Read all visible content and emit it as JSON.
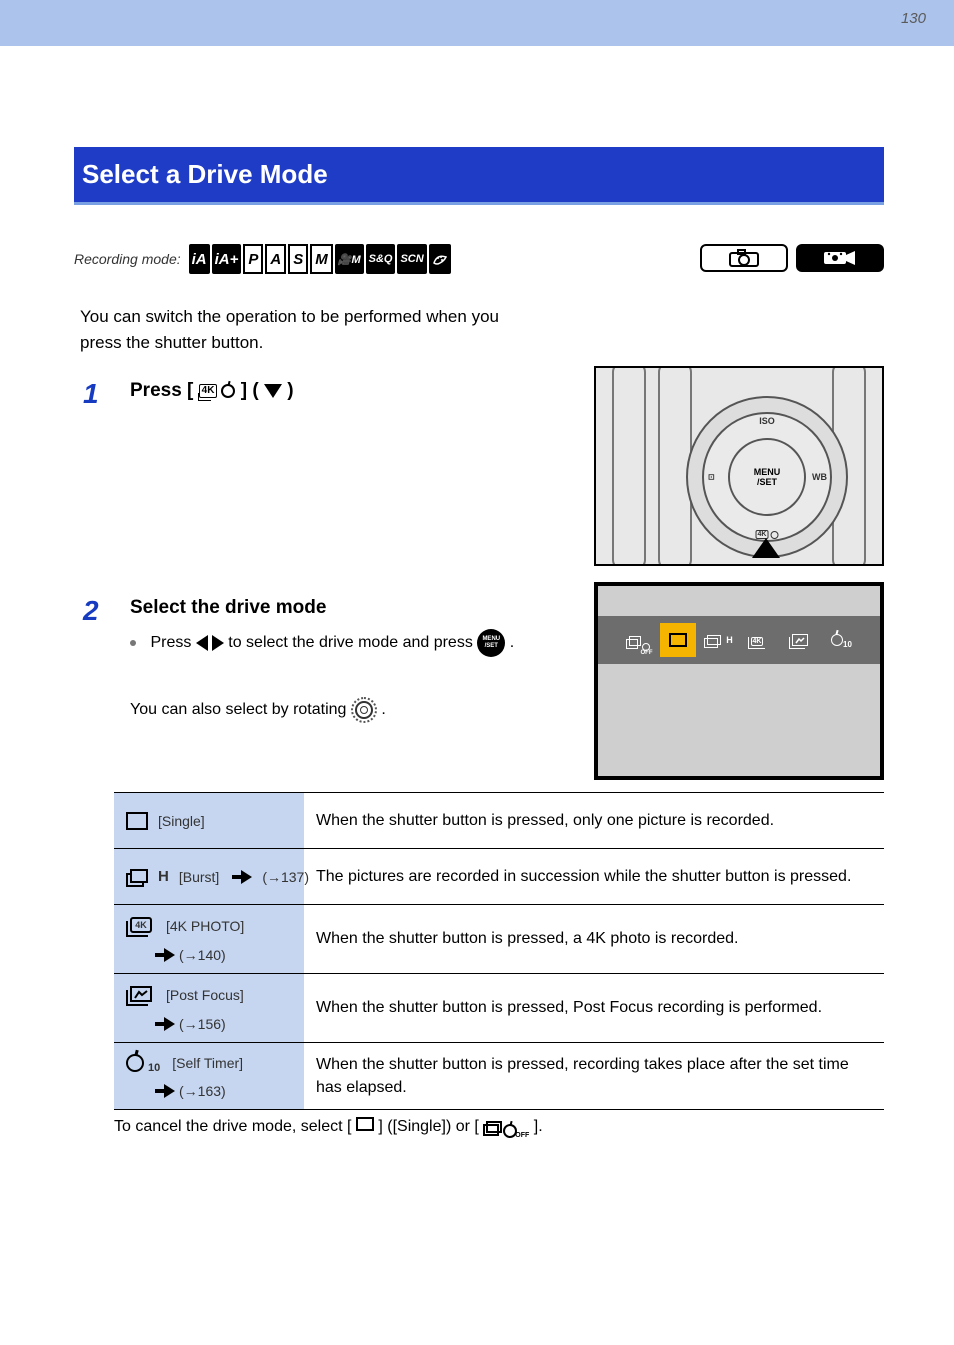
{
  "page_number": "130",
  "title": "Select a Drive Mode",
  "rec_mode_label": "Recording mode:",
  "modes": [
    "iA",
    "iA+",
    "P",
    "A",
    "S",
    "M",
    "🎥M",
    "S&Q",
    "SCN",
    "🎨"
  ],
  "intro": "You can switch the operation to be performed when you press the shutter button.",
  "step1": {
    "num": "1",
    "part1": "Press [",
    "part2": "] (",
    "part3": ")"
  },
  "step2": {
    "num": "2",
    "line": "Select the drive mode",
    "bullet_a": "Press ",
    "bullet_b": " to select the drive mode and press ",
    "bullet_c": "."
  },
  "note": "You can also select by rotating ",
  "note_end": ".",
  "table": [
    {
      "name": "[Single]",
      "desc": "When the shutter button is pressed, only one picture is recorded."
    },
    {
      "name": "[Burst]",
      "ref": "(→137)",
      "desc": "The pictures are recorded in succession while the shutter button is pressed."
    },
    {
      "name": "[4K PHOTO]",
      "ref": "(→140)",
      "desc": "When the shutter button is pressed, a 4K photo is recorded."
    },
    {
      "name": "[Post Focus]",
      "ref": "(→156)",
      "desc": "When the shutter button is pressed, Post Focus recording is performed."
    },
    {
      "name": "[Self Timer]",
      "ref": "(→163)",
      "desc": "When the shutter button is pressed, recording takes place after the set time has elapsed."
    }
  ],
  "cancel_a": "To cancel the drive mode, select [",
  "cancel_b": "] ([Single]) or [",
  "cancel_c": "]."
}
